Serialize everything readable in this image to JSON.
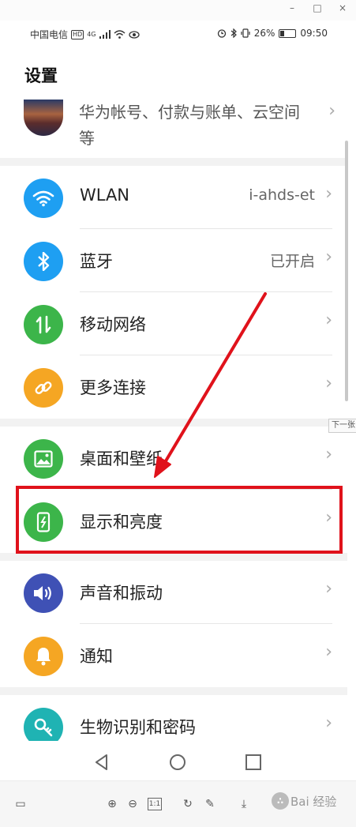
{
  "status_bar": {
    "carrier": "中国电信",
    "hd": "HD",
    "network": "4G",
    "battery": "26%",
    "battery_level": 0.26,
    "time": "09:50"
  },
  "page_title": "设置",
  "account": {
    "text": "华为帐号、付款与账单、云空间等"
  },
  "sections": [
    [
      {
        "label": "WLAN",
        "value": "i-ahds-et",
        "icon": "wifi-icon",
        "color": "#1e9ff2"
      },
      {
        "label": "蓝牙",
        "value": "已开启",
        "icon": "bluetooth-icon",
        "color": "#1e9ff2"
      },
      {
        "label": "移动网络",
        "value": "",
        "icon": "mobile-data-icon",
        "color": "#3cb54a"
      },
      {
        "label": "更多连接",
        "value": "",
        "icon": "link-icon",
        "color": "#f5a623"
      }
    ],
    [
      {
        "label": "桌面和壁纸",
        "value": "",
        "icon": "wallpaper-icon",
        "color": "#3cb54a"
      },
      {
        "label": "显示和亮度",
        "value": "",
        "icon": "display-brightness-icon",
        "color": "#3cb54a"
      }
    ],
    [
      {
        "label": "声音和振动",
        "value": "",
        "icon": "volume-icon",
        "color": "#3f51b5"
      },
      {
        "label": "通知",
        "value": "",
        "icon": "bell-icon",
        "color": "#f5a623"
      }
    ],
    [
      {
        "label": "生物识别和密码",
        "value": "",
        "icon": "key-icon",
        "color": "#1fb3b3"
      }
    ]
  ],
  "next_tab": "下一张",
  "watermark": "Bai 经验",
  "highlight_color": "#e0121b"
}
